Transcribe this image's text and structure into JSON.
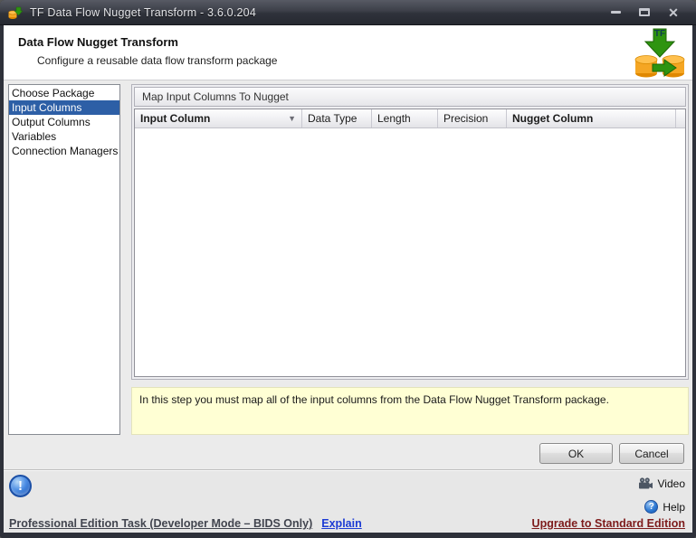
{
  "window": {
    "title": "TF Data Flow Nugget Transform - 3.6.0.204"
  },
  "icons": {
    "close": "✕",
    "info": "!",
    "help": "?",
    "sort_desc": "▼"
  },
  "header": {
    "title": "Data Flow Nugget Transform",
    "subtitle": "Configure a reusable data flow transform package",
    "icon_label": "TF"
  },
  "sidebar": {
    "items": [
      {
        "label": "Choose Package",
        "selected": false
      },
      {
        "label": "Input Columns",
        "selected": true
      },
      {
        "label": "Output Columns",
        "selected": false
      },
      {
        "label": "Variables",
        "selected": false
      },
      {
        "label": "Connection Managers",
        "selected": false
      }
    ]
  },
  "main": {
    "group_title": "Map Input Columns To Nugget",
    "table": {
      "columns": [
        {
          "label": "Input Column",
          "bold": true,
          "sort_icon": "▼"
        },
        {
          "label": "Data Type",
          "bold": false
        },
        {
          "label": "Length",
          "bold": false
        },
        {
          "label": "Precision",
          "bold": false
        },
        {
          "label": "Nugget Column",
          "bold": true
        }
      ],
      "rows": []
    },
    "info_text": "In this step you must map all of the input columns from the Data Flow Nugget Transform package."
  },
  "buttons": {
    "ok": "OK",
    "cancel": "Cancel"
  },
  "footer": {
    "video_label": "Video",
    "help_label": "Help",
    "edition_text": "Professional Edition Task (Developer Mode – BIDS Only)",
    "explain_link": "Explain",
    "upgrade_link": "Upgrade to Standard Edition"
  },
  "colors": {
    "titlebar": "#33363e",
    "selection_blue": "#2d5fa6",
    "info_bg": "#ffffd4",
    "link_blue": "#1c3bd4",
    "link_red": "#7d1b1b",
    "cylinder_orange": "#f5a623",
    "arrow_green": "#2e9410"
  }
}
